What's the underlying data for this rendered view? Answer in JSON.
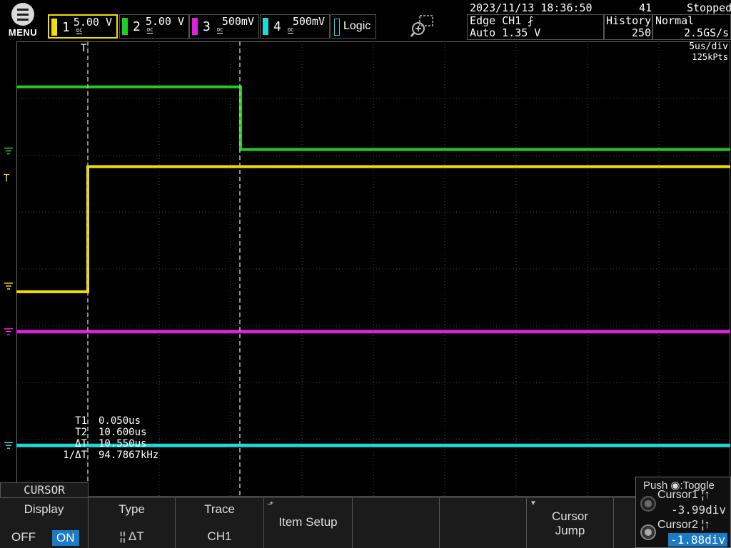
{
  "menu": {
    "label": "MENU"
  },
  "channels": [
    {
      "num": "1",
      "coupling": "DC",
      "scale": "5.00 V",
      "color": "#f3e000"
    },
    {
      "num": "2",
      "coupling": "DC",
      "scale": "5.00 V",
      "color": "#22cc22"
    },
    {
      "num": "3",
      "coupling": "DC",
      "scale": "500mV",
      "color": "#e020e0"
    },
    {
      "num": "4",
      "coupling": "DC",
      "scale": "500mV",
      "color": "#20d8d8"
    }
  ],
  "logic": {
    "label": "Logic"
  },
  "status": {
    "datetime": "2023/11/13 18:36:50",
    "acq_count": "41",
    "state": "Stopped"
  },
  "trigger": {
    "line1": "Edge CH1",
    "line2": "Auto 1.35 V"
  },
  "history": {
    "label": "History",
    "value": "250"
  },
  "acq_mode": {
    "label": "Normal",
    "rate": "2.5GS/s"
  },
  "timebase": {
    "scale": "5us/div",
    "points": "125kPts"
  },
  "cursor_readout": [
    {
      "label": "T1",
      "value": "0.050us"
    },
    {
      "label": "T2",
      "value": "10.600us"
    },
    {
      "label": "ΔT",
      "value": "10.550us"
    },
    {
      "label": "1/ΔT",
      "value": "94.7867kHz"
    }
  ],
  "cursor_menu": {
    "tab": "CURSOR",
    "display": {
      "title": "Display",
      "off": "OFF",
      "on": "ON"
    },
    "type": {
      "title": "Type",
      "value": "¦¦ ΔT"
    },
    "trace": {
      "title": "Trace",
      "value": "CH1"
    },
    "item_setup": {
      "label": "Item Setup"
    },
    "cursor_jump": {
      "line1": "Cursor",
      "line2": "Jump"
    }
  },
  "knob_panel": {
    "push": "Push ◉:Toggle",
    "cursor1": {
      "label": "Cursor1",
      "value": "-3.99div"
    },
    "cursor2": {
      "label": "Cursor2",
      "value": "-1.88div"
    }
  },
  "waveforms": {
    "ch1": {
      "low_div": -0.4,
      "high_div": 1.8,
      "edge_div": 1.0
    },
    "ch2": {
      "high_div": 3.2,
      "low_div": 2.1,
      "edge_div": 3.14
    },
    "ch3": {
      "level_div": -1.1
    },
    "ch4": {
      "level_div": -3.1
    },
    "cursor1_div": 1.0,
    "cursor2_div": 3.13
  }
}
